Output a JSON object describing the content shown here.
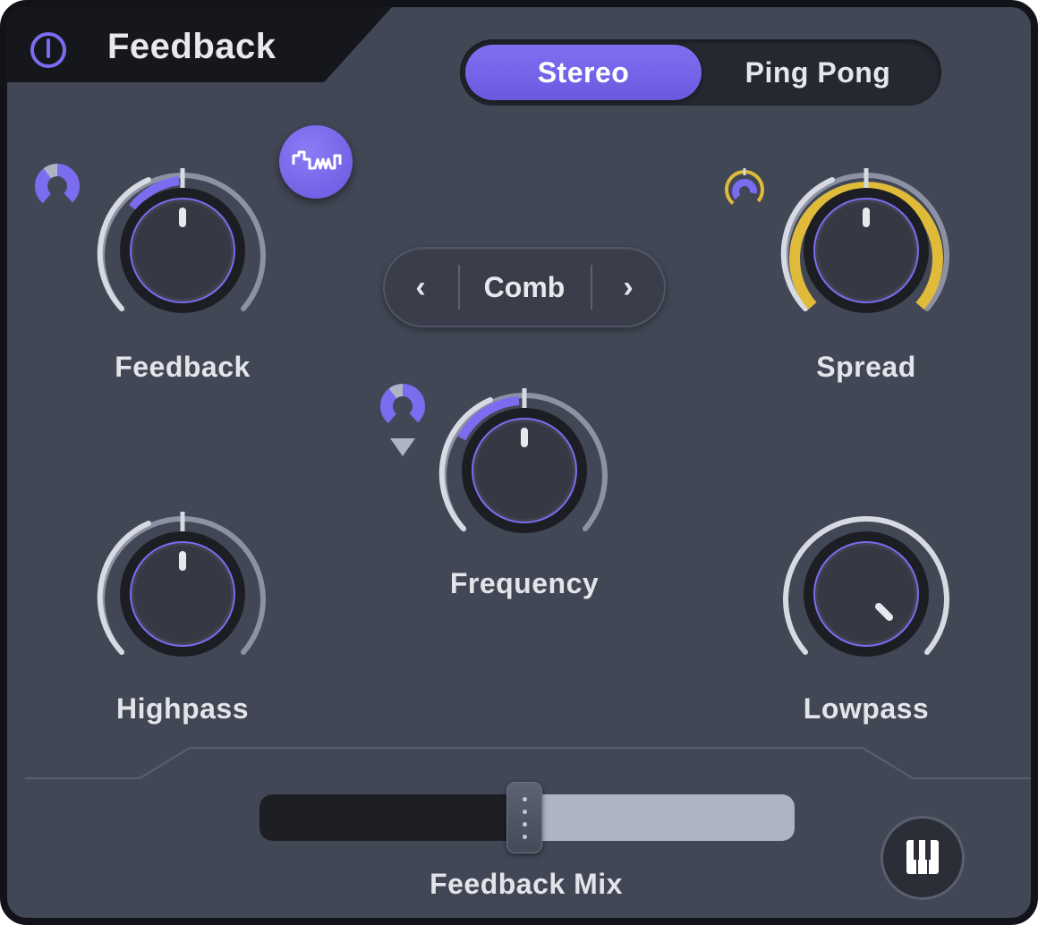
{
  "header": {
    "title": "Feedback"
  },
  "mode": {
    "options": [
      "Stereo",
      "Ping Pong"
    ],
    "selected": "Stereo"
  },
  "filter_type": {
    "value": "Comb",
    "prev": "‹",
    "next": "›"
  },
  "knobs": {
    "feedback": {
      "label": "Feedback",
      "value": 0.5
    },
    "spread": {
      "label": "Spread",
      "value": 0.5
    },
    "frequency": {
      "label": "Frequency",
      "value": 0.5
    },
    "highpass": {
      "label": "Highpass",
      "value": 0.5
    },
    "lowpass": {
      "label": "Lowpass",
      "value": 0.87
    }
  },
  "mix": {
    "label": "Feedback Mix",
    "value": 0.5
  },
  "colors": {
    "accent": "#7b6cf0",
    "spread_mod": "#e0bb3a",
    "panel": "#424755",
    "dark": "#15171d"
  },
  "icons": {
    "power": "power-icon",
    "lfo": "lfo-wave-icon",
    "piano": "piano-keys-icon"
  }
}
